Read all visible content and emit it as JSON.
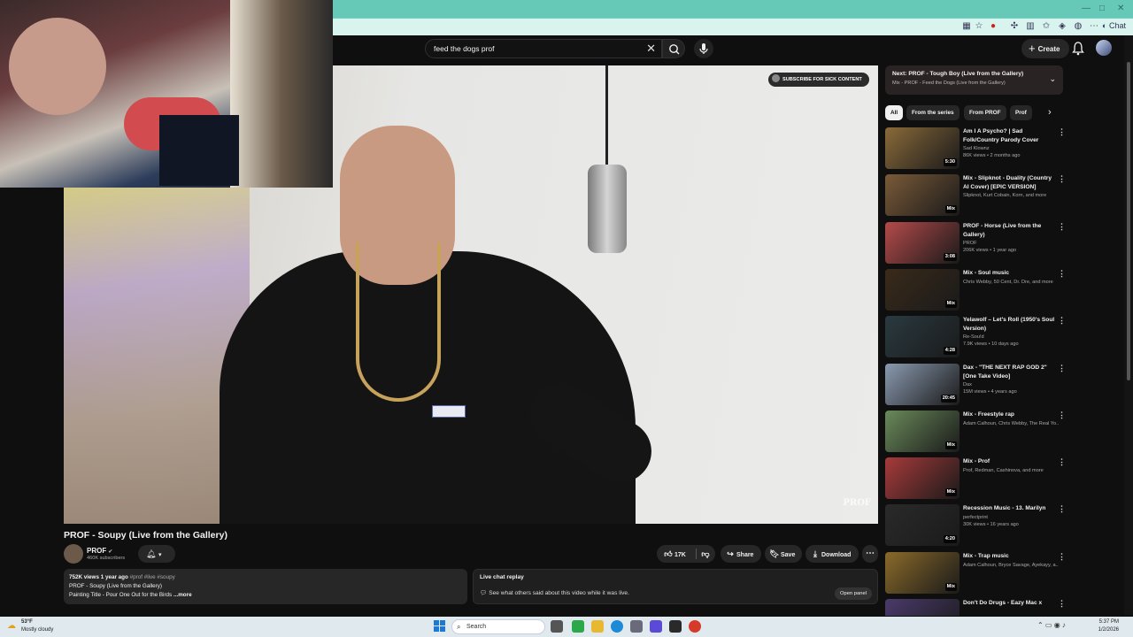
{
  "browser": {
    "chat_label": "Chat"
  },
  "masthead": {
    "search_value": "feed the dogs prof",
    "create_label": "Create"
  },
  "player": {
    "subscribe_overlay": "SUBSCRIBE FOR SICK CONTENT",
    "watermark": "PROF"
  },
  "video": {
    "title": "PROF - Soupy (Live from the Gallery)",
    "channel": "PROF",
    "subscribers": "460K subscribers",
    "likes": "17K",
    "share_label": "Share",
    "save_label": "Save",
    "download_label": "Download",
    "description": {
      "stats": "752K views  1 year ago",
      "tags": "#prof #live #soupy",
      "line2": "PROF - Soupy (Live from the Gallery)",
      "line3": "Painting Title - Pour One Out for the Birds",
      "more": "...more"
    },
    "chat_replay": {
      "title": "Live chat replay",
      "subtitle": "See what others said about this video while it was live.",
      "open_label": "Open panel"
    }
  },
  "upnext": {
    "title": "Next: PROF - Tough Boy (Live from the Gallery)",
    "subtitle": "Mix - PROF - Feed the Dogs (Live from the Gallery)"
  },
  "chips": [
    "All",
    "From the series",
    "From PROF",
    "Prof"
  ],
  "recommendations": [
    {
      "title": "Am I A Psycho? | Sad Folk/Country Parody Cover",
      "channel": "Sad Klownz",
      "meta": "86K views • 2 months ago",
      "badge": "5:30",
      "thumb_color": "#8a6a3a"
    },
    {
      "title": "Mix - Slipknot - Duality (Country AI Cover) [EPIC VERSION]",
      "channel": "Slipknot, Kurt Cobain, Korn, and more",
      "meta": "",
      "badge": "Mix",
      "thumb_color": "#7a5a38"
    },
    {
      "title": "PROF - Horse (Live from the Gallery)",
      "channel": "PROF",
      "meta": "206K views • 1 year ago",
      "badge": "3:08",
      "thumb_color": "#b54a4a"
    },
    {
      "title": "Mix - Soul music",
      "channel": "Chris Webby, 50 Cent, Dr. Dre, and more",
      "meta": "",
      "badge": "Mix",
      "thumb_color": "#3a2a1a"
    },
    {
      "title": "Yelawolf – Let's Roll (1950's Soul Version)",
      "channel": "Re-Sou!d",
      "meta": "7.9K views • 10 days ago",
      "badge": "4:28",
      "thumb_color": "#2a3a40"
    },
    {
      "title": "Dax - \"THE NEXT RAP GOD 2\" [One Take Video]",
      "channel": "Dax",
      "meta": "15M views • 4 years ago",
      "badge": "20:45",
      "thumb_color": "#8a9ab0"
    },
    {
      "title": "Mix - Freestyle rap",
      "channel": "Adam Calhoun, Chris Webby, The Real Yo...",
      "meta": "",
      "badge": "Mix",
      "thumb_color": "#6a8a5a"
    },
    {
      "title": "Mix - Prof",
      "channel": "Prof, Redman, Cashinova, and more",
      "meta": "",
      "badge": "Mix",
      "thumb_color": "#a83a3a"
    },
    {
      "title": "Recession Music - 13. Marilyn",
      "channel": "perfectprint",
      "meta": "30K views • 16 years ago",
      "badge": "4:20",
      "thumb_color": "#2a2a2a"
    },
    {
      "title": "Mix - Trap music",
      "channel": "Adam Calhoun, Bryce Savage, Ayekayy, a...",
      "meta": "",
      "badge": "Mix",
      "thumb_color": "#8a6a2a"
    },
    {
      "title": "Don't Do Drugs - Eazy Mac x",
      "channel": "",
      "meta": "",
      "badge": "",
      "thumb_color": "#4a3a6a"
    }
  ],
  "taskbar": {
    "temp": "53°F",
    "condition": "Mostly cloudy",
    "search_placeholder": "Search",
    "time": "5:37 PM",
    "date": "1/2/2026"
  }
}
